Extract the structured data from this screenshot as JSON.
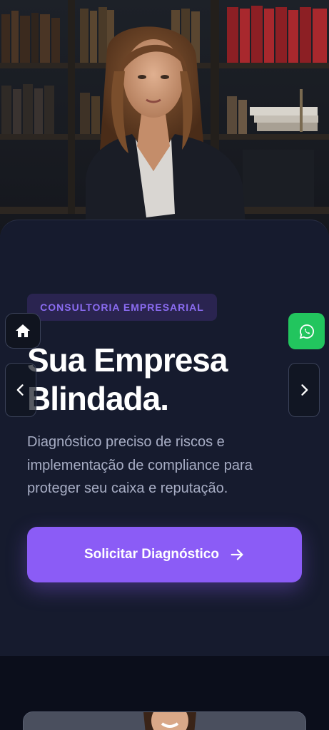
{
  "hero": {
    "badge": "CONSULTORIA EMPRESARIAL",
    "title_line1": "Sua Empresa",
    "title_line2": "Blindada.",
    "description": "Diagnóstico preciso de riscos e implementação de compliance para proteger seu caixa e reputação.",
    "cta_label": "Solicitar Diagnóstico"
  },
  "icons": {
    "home": "home-icon",
    "whatsapp": "whatsapp-icon",
    "prev": "chevron-left-icon",
    "next": "chevron-right-icon",
    "cta_arrow": "arrow-right-icon"
  },
  "colors": {
    "accent": "#8b5cf6",
    "card_bg": "#161b2e",
    "whatsapp": "#22c55e",
    "badge_text": "#8b6cf2"
  }
}
